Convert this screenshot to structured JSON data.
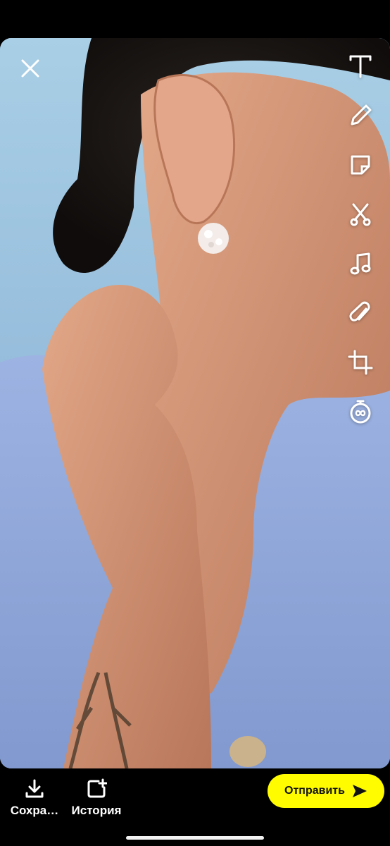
{
  "toolbar": {
    "tools": [
      {
        "name": "text-tool",
        "icon": "text-icon"
      },
      {
        "name": "pencil-tool",
        "icon": "pencil-icon"
      },
      {
        "name": "sticker-tool",
        "icon": "sticker-icon"
      },
      {
        "name": "scissors-tool",
        "icon": "scissors-icon"
      },
      {
        "name": "music-tool",
        "icon": "music-note-icon"
      },
      {
        "name": "attachment-tool",
        "icon": "paperclip-icon"
      },
      {
        "name": "crop-tool",
        "icon": "crop-icon"
      },
      {
        "name": "timer-tool",
        "icon": "timer-icon"
      }
    ]
  },
  "bottom": {
    "save_label": "Сохра…",
    "story_label": "История",
    "send_label": "Отправить"
  },
  "colors": {
    "send_button": "#fffc00",
    "background": "#000000",
    "icon": "#ffffff"
  }
}
